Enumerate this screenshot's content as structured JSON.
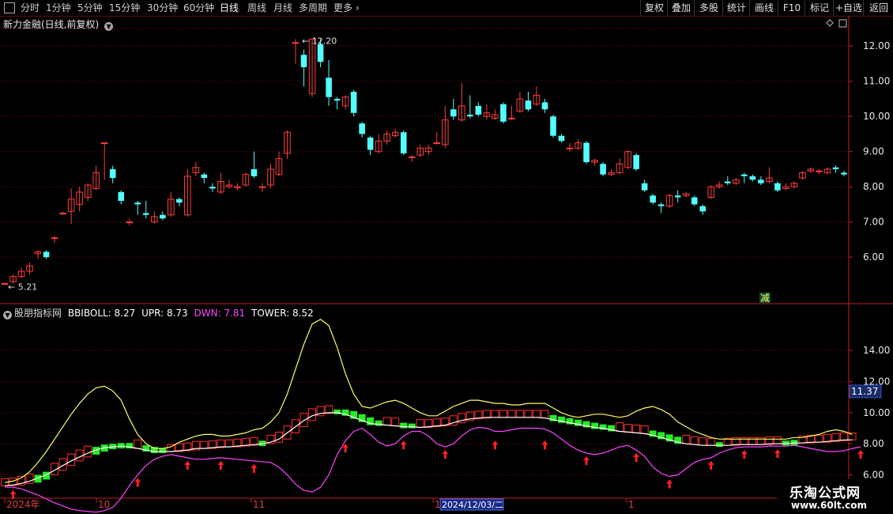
{
  "toolbar": {
    "left_items": [
      "分时",
      "1分钟",
      "5分钟",
      "15分钟",
      "30分钟",
      "60分钟",
      "日线",
      "周线",
      "月线",
      "多周期",
      "更多"
    ],
    "right_items": [
      "复权",
      "叠加",
      "多股",
      "统计",
      "画线",
      "F10",
      "标记",
      "+自选",
      "返回"
    ],
    "active": "日线"
  },
  "main_title": "新力金融(日线,前复权)",
  "indicator": {
    "name": "股朋指标网",
    "bbiboll": "BBIBOLL: 8.27",
    "upr": "UPR: 8.73",
    "dwn": "DWN: 7.81",
    "tower": "TOWER: 8.52",
    "current_value": "11.37",
    "yticks": [
      "14.00",
      "12.00",
      "10.00",
      "8.00",
      "6.00"
    ]
  },
  "annotations": {
    "high": "12.20",
    "low": "5.21",
    "jian": "减"
  },
  "time_axis": [
    {
      "label": "2024年"
    },
    {
      "label": "10"
    },
    {
      "label": "11"
    },
    {
      "label": "1"
    },
    {
      "label": "1"
    }
  ],
  "cursor_date": "2024/12/03/二",
  "colors": {
    "up": "#ff3d3d",
    "down": "#54ffff",
    "grid": "#7a1010",
    "axis": "#c02020",
    "upr": "#ffff66",
    "dwn": "#ff44ff",
    "bbiboll": "#ffffff",
    "tower_up": "#ff3030",
    "tower_down": "#22ee22"
  },
  "watermark": {
    "line1": "乐淘公式网",
    "line2": "www.60lt.com"
  },
  "chart_data": {
    "type": "candlestick",
    "title": "新力金融(日线,前复权)",
    "ylim": [
      4.7,
      12.5
    ],
    "yticks": [
      6,
      7,
      8,
      9,
      10,
      11,
      12
    ],
    "candles": [
      [
        5.25,
        5.25,
        5.28,
        5.21
      ],
      [
        5.3,
        5.45,
        5.5,
        5.25
      ],
      [
        5.45,
        5.6,
        5.7,
        5.4
      ],
      [
        5.6,
        5.75,
        5.85,
        5.5
      ],
      [
        6.1,
        6.15,
        6.2,
        5.95
      ],
      [
        6.15,
        6.0,
        6.2,
        5.95
      ],
      [
        6.55,
        6.55,
        6.6,
        6.4
      ],
      [
        7.25,
        7.25,
        7.3,
        7.2
      ],
      [
        7.3,
        7.65,
        7.95,
        6.95
      ],
      [
        7.5,
        7.85,
        8.0,
        7.3
      ],
      [
        7.7,
        8.05,
        8.1,
        7.6
      ],
      [
        7.95,
        8.4,
        8.6,
        7.9
      ],
      [
        9.25,
        9.25,
        9.25,
        8.2
      ],
      [
        8.5,
        8.25,
        8.6,
        8.1
      ],
      [
        7.85,
        7.6,
        7.9,
        7.5
      ],
      [
        7.0,
        7.0,
        7.1,
        6.9
      ],
      [
        7.55,
        7.5,
        7.6,
        7.2
      ],
      [
        7.25,
        7.2,
        7.6,
        7.1
      ],
      [
        7.0,
        7.15,
        7.3,
        6.95
      ],
      [
        7.2,
        7.1,
        7.3,
        7.05
      ],
      [
        7.2,
        7.65,
        7.85,
        7.15
      ],
      [
        7.65,
        7.55,
        7.7,
        7.45
      ],
      [
        7.2,
        8.3,
        8.5,
        7.15
      ],
      [
        8.4,
        8.55,
        8.7,
        8.3
      ],
      [
        8.35,
        8.25,
        8.4,
        8.1
      ],
      [
        8.0,
        7.95,
        8.1,
        7.85
      ],
      [
        7.85,
        8.15,
        8.4,
        7.8
      ],
      [
        8.0,
        8.05,
        8.2,
        7.95
      ],
      [
        8.0,
        8.0,
        8.1,
        7.9
      ],
      [
        8.05,
        8.35,
        8.4,
        8.0
      ],
      [
        8.5,
        8.3,
        9.0,
        8.25
      ],
      [
        8.0,
        8.0,
        8.1,
        7.85
      ],
      [
        8.05,
        8.5,
        8.65,
        7.95
      ],
      [
        8.35,
        8.8,
        9.0,
        8.3
      ],
      [
        8.95,
        9.55,
        9.6,
        8.8
      ],
      [
        12.1,
        12.1,
        12.2,
        11.5
      ],
      [
        11.75,
        11.4,
        11.9,
        10.85
      ],
      [
        10.65,
        12.2,
        12.2,
        10.55
      ],
      [
        12.05,
        11.55,
        12.2,
        11.4
      ],
      [
        11.1,
        10.55,
        11.6,
        10.3
      ],
      [
        10.5,
        10.45,
        10.55,
        10.2
      ],
      [
        10.3,
        10.55,
        10.6,
        10.2
      ],
      [
        10.7,
        10.1,
        10.75,
        10.0
      ],
      [
        9.8,
        9.5,
        9.85,
        9.4
      ],
      [
        9.4,
        9.05,
        9.45,
        8.9
      ],
      [
        9.0,
        9.3,
        9.5,
        8.95
      ],
      [
        9.3,
        9.5,
        9.6,
        9.2
      ],
      [
        9.45,
        9.55,
        9.65,
        9.4
      ],
      [
        9.55,
        8.95,
        9.6,
        8.9
      ],
      [
        8.85,
        8.85,
        8.9,
        8.7
      ],
      [
        8.9,
        9.1,
        9.2,
        8.85
      ],
      [
        9.0,
        9.1,
        9.2,
        8.9
      ],
      [
        9.25,
        9.25,
        9.55,
        9.2
      ],
      [
        9.2,
        9.9,
        10.3,
        9.1
      ],
      [
        10.2,
        10.0,
        10.5,
        9.9
      ],
      [
        9.9,
        10.3,
        10.95,
        9.85
      ],
      [
        10.05,
        10.0,
        10.6,
        9.95
      ],
      [
        10.3,
        10.05,
        10.4,
        10.0
      ],
      [
        10.0,
        10.1,
        10.35,
        9.9
      ],
      [
        9.95,
        10.05,
        10.2,
        9.9
      ],
      [
        10.35,
        9.85,
        10.4,
        9.8
      ],
      [
        9.95,
        9.95,
        10.3,
        9.9
      ],
      [
        10.15,
        10.5,
        10.7,
        10.1
      ],
      [
        10.45,
        10.2,
        10.7,
        10.15
      ],
      [
        10.35,
        10.6,
        10.85,
        10.3
      ],
      [
        10.4,
        10.2,
        10.5,
        10.1
      ],
      [
        10.0,
        9.45,
        10.05,
        9.4
      ],
      [
        9.45,
        9.3,
        9.5,
        9.25
      ],
      [
        9.1,
        9.1,
        9.25,
        9.0
      ],
      [
        9.1,
        9.25,
        9.35,
        9.05
      ],
      [
        9.25,
        8.7,
        9.3,
        8.65
      ],
      [
        8.7,
        8.75,
        8.8,
        8.6
      ],
      [
        8.65,
        8.35,
        8.7,
        8.3
      ],
      [
        8.35,
        8.4,
        8.5,
        8.3
      ],
      [
        8.4,
        8.65,
        8.8,
        8.35
      ],
      [
        8.55,
        9.0,
        9.05,
        8.5
      ],
      [
        8.9,
        8.5,
        8.95,
        8.45
      ],
      [
        8.1,
        7.9,
        8.2,
        7.85
      ],
      [
        7.75,
        7.55,
        7.8,
        7.5
      ],
      [
        7.5,
        7.45,
        7.55,
        7.25
      ],
      [
        7.45,
        7.75,
        7.8,
        7.4
      ],
      [
        7.75,
        7.7,
        7.9,
        7.55
      ],
      [
        7.75,
        7.8,
        7.85,
        7.7
      ],
      [
        7.7,
        7.5,
        7.75,
        7.45
      ],
      [
        7.45,
        7.3,
        7.5,
        7.2
      ],
      [
        7.7,
        8.0,
        8.05,
        7.65
      ],
      [
        8.0,
        8.05,
        8.15,
        7.95
      ],
      [
        8.15,
        8.1,
        8.3,
        8.05
      ],
      [
        8.1,
        8.2,
        8.25,
        8.05
      ],
      [
        8.35,
        8.3,
        8.4,
        8.1
      ],
      [
        8.3,
        8.2,
        8.35,
        8.15
      ],
      [
        8.2,
        8.1,
        8.3,
        8.05
      ],
      [
        8.15,
        8.25,
        8.55,
        8.1
      ],
      [
        8.1,
        7.9,
        8.15,
        7.85
      ],
      [
        7.95,
        8.0,
        8.1,
        7.9
      ],
      [
        8.0,
        8.1,
        8.15,
        7.95
      ],
      [
        8.25,
        8.4,
        8.45,
        8.2
      ],
      [
        8.45,
        8.5,
        8.55,
        8.4
      ],
      [
        8.45,
        8.45,
        8.5,
        8.35
      ],
      [
        8.4,
        8.5,
        8.55,
        8.35
      ],
      [
        8.55,
        8.5,
        8.6,
        8.4
      ],
      [
        8.4,
        8.35,
        8.45,
        8.3
      ]
    ],
    "indicator": {
      "ylim": [
        4.5,
        16.3
      ],
      "upr": [
        5.5,
        5.6,
        5.8,
        6.2,
        6.8,
        7.5,
        8.3,
        9.1,
        9.9,
        10.6,
        11.2,
        11.6,
        11.7,
        11.4,
        10.8,
        9.6,
        8.6,
        8.0,
        7.7,
        7.7,
        7.8,
        8.1,
        8.3,
        8.5,
        8.6,
        8.6,
        8.5,
        8.5,
        8.6,
        8.7,
        8.9,
        9.0,
        9.4,
        10.0,
        11.2,
        12.8,
        14.4,
        15.7,
        16.0,
        15.6,
        14.2,
        12.5,
        11.2,
        10.4,
        10.3,
        10.5,
        10.7,
        10.8,
        10.6,
        10.3,
        10.0,
        9.8,
        9.8,
        10.1,
        10.4,
        10.6,
        10.8,
        10.8,
        10.7,
        10.6,
        10.6,
        10.5,
        10.5,
        10.6,
        10.6,
        10.6,
        10.3,
        10.0,
        9.8,
        9.7,
        9.8,
        9.9,
        9.9,
        9.8,
        9.7,
        9.8,
        10.1,
        10.3,
        10.4,
        10.2,
        9.9,
        9.4,
        9.1,
        8.8,
        8.6,
        8.4,
        8.3,
        8.3,
        8.3,
        8.3,
        8.3,
        8.3,
        8.3,
        8.3,
        8.3,
        8.4,
        8.4,
        8.5,
        8.6,
        8.8,
        8.9,
        8.8,
        8.6
      ],
      "bbiboll": [
        5.3,
        5.35,
        5.45,
        5.6,
        5.8,
        6.0,
        6.3,
        6.6,
        6.9,
        7.15,
        7.4,
        7.6,
        7.75,
        7.8,
        7.85,
        7.8,
        7.7,
        7.6,
        7.5,
        7.5,
        7.5,
        7.55,
        7.6,
        7.7,
        7.7,
        7.75,
        7.8,
        7.8,
        7.85,
        7.9,
        7.95,
        8.0,
        8.1,
        8.3,
        8.7,
        9.1,
        9.5,
        9.8,
        9.95,
        10.0,
        10.0,
        9.9,
        9.7,
        9.5,
        9.3,
        9.25,
        9.2,
        9.15,
        9.1,
        9.1,
        9.05,
        9.1,
        9.15,
        9.2,
        9.35,
        9.5,
        9.6,
        9.65,
        9.7,
        9.7,
        9.7,
        9.7,
        9.7,
        9.7,
        9.7,
        9.65,
        9.55,
        9.45,
        9.35,
        9.25,
        9.15,
        9.05,
        9.0,
        8.9,
        8.8,
        8.75,
        8.7,
        8.65,
        8.55,
        8.4,
        8.25,
        8.1,
        8.0,
        7.95,
        7.9,
        7.9,
        7.9,
        7.9,
        7.95,
        7.95,
        7.95,
        7.95,
        8.0,
        8.0,
        8.0,
        8.05,
        8.05,
        8.1,
        8.1,
        8.15,
        8.2,
        8.25,
        8.25
      ],
      "dwn": [
        5.2,
        5.2,
        5.1,
        4.9,
        4.7,
        4.45,
        4.2,
        4.0,
        3.8,
        3.7,
        3.65,
        3.6,
        3.7,
        3.9,
        4.5,
        5.3,
        6.0,
        6.6,
        7.0,
        7.2,
        7.3,
        7.2,
        7.1,
        7.0,
        7.0,
        7.05,
        7.1,
        7.05,
        7.0,
        6.95,
        6.9,
        6.85,
        6.8,
        6.5,
        6.0,
        5.4,
        5.0,
        4.9,
        5.2,
        6.0,
        7.3,
        8.2,
        8.8,
        9.0,
        8.6,
        8.1,
        7.85,
        8.0,
        8.5,
        8.8,
        8.8,
        8.5,
        8.0,
        7.8,
        8.0,
        8.5,
        8.9,
        9.05,
        9.0,
        8.8,
        8.8,
        8.9,
        9.0,
        9.0,
        9.0,
        8.95,
        8.7,
        8.3,
        7.9,
        7.6,
        7.4,
        7.3,
        7.4,
        7.6,
        7.8,
        7.9,
        7.6,
        7.2,
        6.5,
        6.1,
        5.9,
        6.0,
        6.4,
        6.8,
        7.0,
        7.1,
        7.4,
        7.6,
        7.75,
        7.8,
        7.8,
        7.8,
        7.85,
        7.85,
        7.85,
        7.9,
        7.8,
        7.7,
        7.6,
        7.5,
        7.5,
        7.55,
        7.7,
        7.8
      ],
      "tower_up": [
        1,
        1,
        1,
        1,
        0,
        0,
        1,
        1,
        1,
        1,
        1,
        0,
        0,
        0,
        0,
        0,
        1,
        0,
        0,
        0,
        1,
        1,
        1,
        1,
        1,
        1,
        1,
        1,
        1,
        1,
        1,
        0,
        1,
        1,
        1,
        1,
        1,
        1,
        1,
        1,
        0,
        0,
        0,
        0,
        0,
        0,
        1,
        1,
        0,
        0,
        1,
        1,
        1,
        1,
        1,
        1,
        1,
        1,
        1,
        1,
        1,
        1,
        1,
        1,
        1,
        1,
        0,
        0,
        0,
        0,
        0,
        0,
        0,
        0,
        1,
        1,
        1,
        1,
        0,
        0,
        0,
        0,
        1,
        1,
        1,
        1,
        0,
        1,
        1,
        1,
        1,
        1,
        1,
        1,
        0,
        0,
        1,
        1,
        1,
        1,
        1,
        1,
        1,
        1
      ]
    },
    "arrows": [
      1,
      16,
      22,
      26,
      30,
      41,
      48,
      53,
      59,
      65,
      70,
      76,
      80,
      85,
      89,
      93,
      103
    ]
  }
}
